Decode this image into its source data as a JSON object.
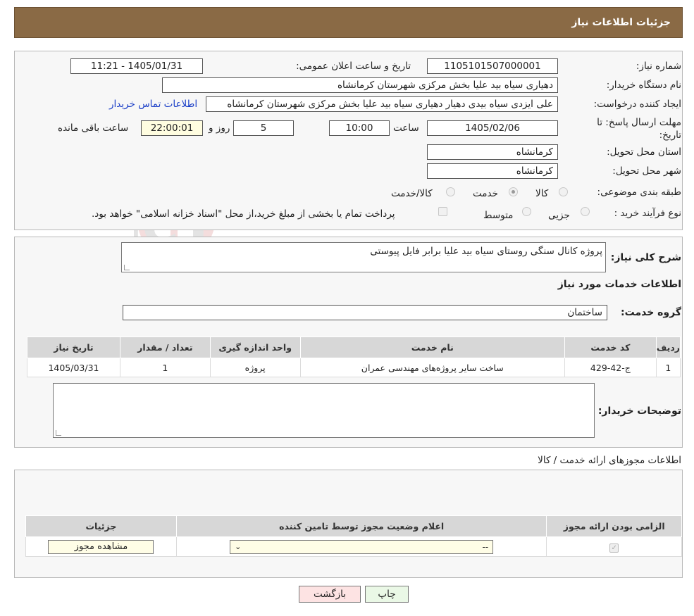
{
  "header": {
    "title": "جزئیات اطلاعات نیاز"
  },
  "watermark": {
    "text": "AriaTender.neT"
  },
  "details": {
    "need_number_label": "شماره نیاز:",
    "need_number": "1105101507000001",
    "announce_label": "تاریخ و ساعت اعلان عمومی:",
    "announce_value": "1405/01/31 - 11:21",
    "buyer_org_label": "نام دستگاه خریدار:",
    "buyer_org": "دهیاری سیاه بید علیا بخش مرکزی شهرستان کرمانشاه",
    "creator_label": "ایجاد کننده درخواست:",
    "creator": "علی ایزدی سیاه بیدی دهیار دهیاری سیاه بید علیا بخش مرکزی شهرستان کرمانشاه",
    "contact_link": "اطلاعات تماس خریدار",
    "deadline_label": "مهلت ارسال پاسخ: تا تاریخ:",
    "deadline_date": "1405/02/06",
    "time_label": "ساعت",
    "deadline_time": "10:00",
    "days_value": "5",
    "days_label": "روز و",
    "remaining_time": "22:00:01",
    "remaining_label": "ساعت باقی مانده",
    "province_label": "استان محل تحویل:",
    "province": "کرمانشاه",
    "city_label": "شهر محل تحویل:",
    "city": "کرمانشاه",
    "category_label": "طبقه بندی موضوعی:",
    "category_options": [
      "کالا",
      "خدمت",
      "کالا/خدمت"
    ],
    "category_selected": "خدمت",
    "process_label": "نوع فرآیند خرید :",
    "process_options": [
      "جزیی",
      "متوسط"
    ],
    "process_note": "پرداخت تمام یا بخشی از مبلغ خرید،از محل \"اسناد خزانه اسلامی\" خواهد بود."
  },
  "summary": {
    "label": "شرح کلی نیاز:",
    "text": "پروژه کانال سنگی روستای سیاه بید علیا برابر فایل پیوستی",
    "services_heading": "اطلاعات خدمات مورد نیاز",
    "group_label": "گروه خدمت:",
    "group_value": "ساختمان"
  },
  "services_table": {
    "headers": [
      "ردیف",
      "کد خدمت",
      "نام خدمت",
      "واحد اندازه گیری",
      "تعداد / مقدار",
      "تاریخ نیاز"
    ],
    "rows": [
      [
        "1",
        "ج-42-429",
        "ساخت سایر پروژه‌های مهندسی عمران",
        "پروژه",
        "1",
        "1405/03/31"
      ]
    ]
  },
  "buyer_notes": {
    "label": "توضیحات خریدار:",
    "text": ""
  },
  "permits": {
    "heading": "اطلاعات مجوزهای ارائه خدمت / کالا",
    "headers": [
      "الزامی بودن ارائه مجوز",
      "اعلام وضعیت مجوز توسط تامین کننده",
      "جزئیات"
    ],
    "select_value": "--",
    "view_button": "مشاهده مجوز"
  },
  "actions": {
    "print": "چاپ",
    "back": "بازگشت"
  },
  "colors": {
    "header_bg": "#8a6a45",
    "link": "#1a3ec7",
    "back_button_bg": "#fde3e3",
    "print_button_bg": "#eaf8e6"
  }
}
